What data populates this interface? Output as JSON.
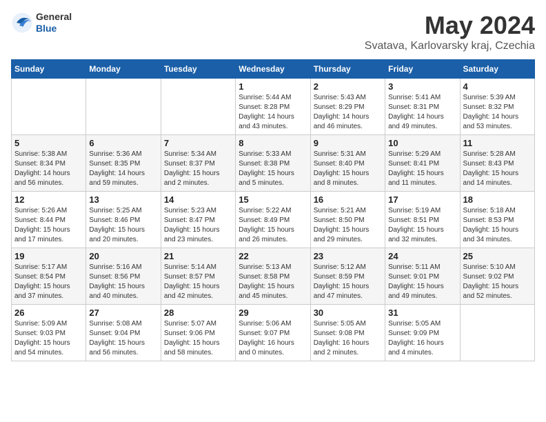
{
  "header": {
    "logo": {
      "general": "General",
      "blue": "Blue"
    },
    "title": "May 2024",
    "location": "Svatava, Karlovarsky kraj, Czechia"
  },
  "days_of_week": [
    "Sunday",
    "Monday",
    "Tuesday",
    "Wednesday",
    "Thursday",
    "Friday",
    "Saturday"
  ],
  "weeks": [
    [
      {
        "day": "",
        "info": ""
      },
      {
        "day": "",
        "info": ""
      },
      {
        "day": "",
        "info": ""
      },
      {
        "day": "1",
        "info": "Sunrise: 5:44 AM\nSunset: 8:28 PM\nDaylight: 14 hours and 43 minutes."
      },
      {
        "day": "2",
        "info": "Sunrise: 5:43 AM\nSunset: 8:29 PM\nDaylight: 14 hours and 46 minutes."
      },
      {
        "day": "3",
        "info": "Sunrise: 5:41 AM\nSunset: 8:31 PM\nDaylight: 14 hours and 49 minutes."
      },
      {
        "day": "4",
        "info": "Sunrise: 5:39 AM\nSunset: 8:32 PM\nDaylight: 14 hours and 53 minutes."
      }
    ],
    [
      {
        "day": "5",
        "info": "Sunrise: 5:38 AM\nSunset: 8:34 PM\nDaylight: 14 hours and 56 minutes."
      },
      {
        "day": "6",
        "info": "Sunrise: 5:36 AM\nSunset: 8:35 PM\nDaylight: 14 hours and 59 minutes."
      },
      {
        "day": "7",
        "info": "Sunrise: 5:34 AM\nSunset: 8:37 PM\nDaylight: 15 hours and 2 minutes."
      },
      {
        "day": "8",
        "info": "Sunrise: 5:33 AM\nSunset: 8:38 PM\nDaylight: 15 hours and 5 minutes."
      },
      {
        "day": "9",
        "info": "Sunrise: 5:31 AM\nSunset: 8:40 PM\nDaylight: 15 hours and 8 minutes."
      },
      {
        "day": "10",
        "info": "Sunrise: 5:29 AM\nSunset: 8:41 PM\nDaylight: 15 hours and 11 minutes."
      },
      {
        "day": "11",
        "info": "Sunrise: 5:28 AM\nSunset: 8:43 PM\nDaylight: 15 hours and 14 minutes."
      }
    ],
    [
      {
        "day": "12",
        "info": "Sunrise: 5:26 AM\nSunset: 8:44 PM\nDaylight: 15 hours and 17 minutes."
      },
      {
        "day": "13",
        "info": "Sunrise: 5:25 AM\nSunset: 8:46 PM\nDaylight: 15 hours and 20 minutes."
      },
      {
        "day": "14",
        "info": "Sunrise: 5:23 AM\nSunset: 8:47 PM\nDaylight: 15 hours and 23 minutes."
      },
      {
        "day": "15",
        "info": "Sunrise: 5:22 AM\nSunset: 8:49 PM\nDaylight: 15 hours and 26 minutes."
      },
      {
        "day": "16",
        "info": "Sunrise: 5:21 AM\nSunset: 8:50 PM\nDaylight: 15 hours and 29 minutes."
      },
      {
        "day": "17",
        "info": "Sunrise: 5:19 AM\nSunset: 8:51 PM\nDaylight: 15 hours and 32 minutes."
      },
      {
        "day": "18",
        "info": "Sunrise: 5:18 AM\nSunset: 8:53 PM\nDaylight: 15 hours and 34 minutes."
      }
    ],
    [
      {
        "day": "19",
        "info": "Sunrise: 5:17 AM\nSunset: 8:54 PM\nDaylight: 15 hours and 37 minutes."
      },
      {
        "day": "20",
        "info": "Sunrise: 5:16 AM\nSunset: 8:56 PM\nDaylight: 15 hours and 40 minutes."
      },
      {
        "day": "21",
        "info": "Sunrise: 5:14 AM\nSunset: 8:57 PM\nDaylight: 15 hours and 42 minutes."
      },
      {
        "day": "22",
        "info": "Sunrise: 5:13 AM\nSunset: 8:58 PM\nDaylight: 15 hours and 45 minutes."
      },
      {
        "day": "23",
        "info": "Sunrise: 5:12 AM\nSunset: 8:59 PM\nDaylight: 15 hours and 47 minutes."
      },
      {
        "day": "24",
        "info": "Sunrise: 5:11 AM\nSunset: 9:01 PM\nDaylight: 15 hours and 49 minutes."
      },
      {
        "day": "25",
        "info": "Sunrise: 5:10 AM\nSunset: 9:02 PM\nDaylight: 15 hours and 52 minutes."
      }
    ],
    [
      {
        "day": "26",
        "info": "Sunrise: 5:09 AM\nSunset: 9:03 PM\nDaylight: 15 hours and 54 minutes."
      },
      {
        "day": "27",
        "info": "Sunrise: 5:08 AM\nSunset: 9:04 PM\nDaylight: 15 hours and 56 minutes."
      },
      {
        "day": "28",
        "info": "Sunrise: 5:07 AM\nSunset: 9:06 PM\nDaylight: 15 hours and 58 minutes."
      },
      {
        "day": "29",
        "info": "Sunrise: 5:06 AM\nSunset: 9:07 PM\nDaylight: 16 hours and 0 minutes."
      },
      {
        "day": "30",
        "info": "Sunrise: 5:05 AM\nSunset: 9:08 PM\nDaylight: 16 hours and 2 minutes."
      },
      {
        "day": "31",
        "info": "Sunrise: 5:05 AM\nSunset: 9:09 PM\nDaylight: 16 hours and 4 minutes."
      },
      {
        "day": "",
        "info": ""
      }
    ]
  ]
}
